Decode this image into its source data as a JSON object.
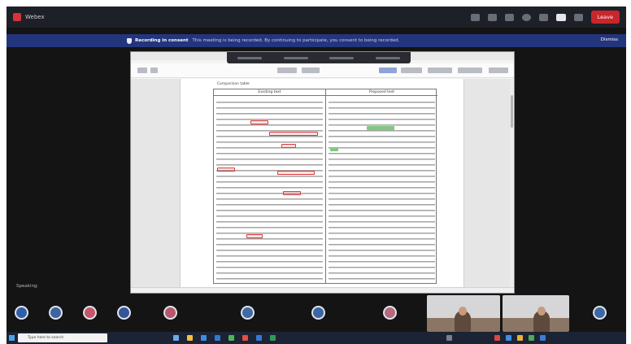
{
  "app": {
    "title": "Webex"
  },
  "window": {
    "leave_label": "Leave"
  },
  "notification": {
    "strong": "Recording in consent",
    "message": "This meeting is being recorded. By continuing to participate, you consent to being recorded.",
    "dismiss_label": "Dismiss"
  },
  "document": {
    "page_title": "Comparison table",
    "col_left_title": "Existing text",
    "col_right_title": "Proposed text"
  },
  "speaking": {
    "label": "Speaking:"
  },
  "participants": [
    {
      "name": ""
    },
    {
      "name": ""
    },
    {
      "name": ""
    },
    {
      "name": ""
    },
    {
      "name": ""
    },
    {
      "name": ""
    },
    {
      "name": ""
    },
    {
      "name": ""
    },
    {
      "name": ""
    }
  ],
  "taskbar": {
    "search_placeholder": "Type here to search",
    "clock": ""
  },
  "colors": {
    "title_bar": "#1e2027",
    "notice_bar": "#23357c",
    "leave_button": "#c9262c",
    "background": "#141414",
    "avatar_ring": "#dfe3ec"
  }
}
